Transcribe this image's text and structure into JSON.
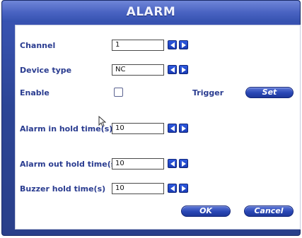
{
  "dialog": {
    "title": "ALARM"
  },
  "rows": {
    "channel": {
      "label": "Channel",
      "value": "1"
    },
    "device_type": {
      "label": "Device type",
      "value": "NC"
    },
    "enable": {
      "label": "Enable",
      "checked": false
    },
    "trigger": {
      "label": "Trigger",
      "button": "Set"
    },
    "alarm_in_hold": {
      "label": "Alarm in hold time(s)",
      "value": "10"
    },
    "alarm_out_hold": {
      "label": "Alarm out hold time(s)",
      "value": "10"
    },
    "buzzer_hold": {
      "label": "Buzzer hold time(s)",
      "value": "10"
    }
  },
  "buttons": {
    "ok": "OK",
    "cancel": "Cancel"
  },
  "icons": {
    "prev": "arrow-left-icon",
    "next": "arrow-right-icon",
    "pointer": "mouse-pointer-icon"
  },
  "colors": {
    "accent": "#2a3c90",
    "frame": "#2c4596"
  }
}
